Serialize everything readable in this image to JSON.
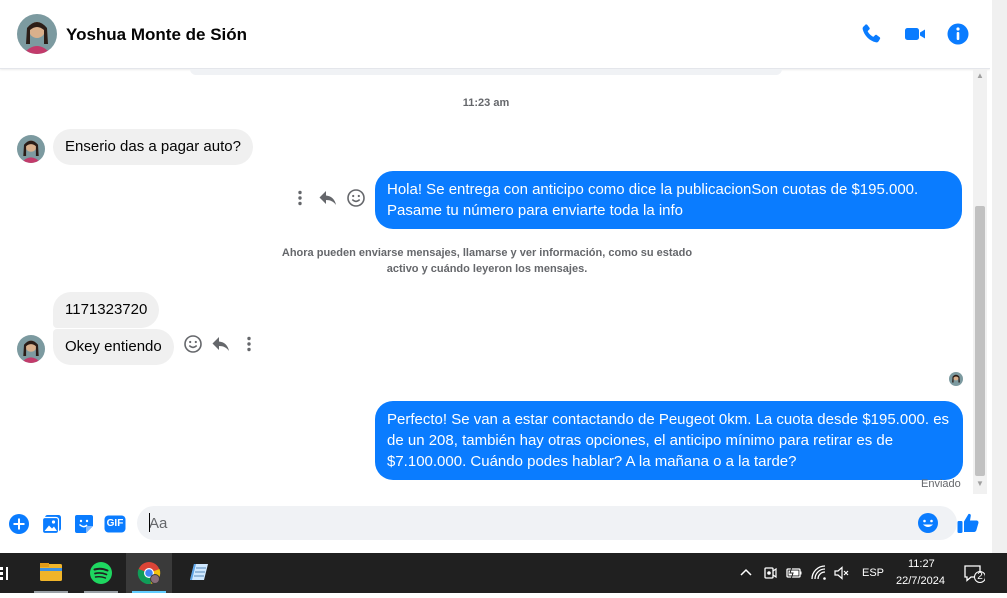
{
  "header": {
    "contact_name": "Yoshua Monte de Sión",
    "icons": [
      "phone-icon",
      "video-camera-icon",
      "info-icon"
    ]
  },
  "thread": {
    "timestamp": "11:23 am",
    "messages": [
      {
        "direction": "in",
        "text": "Enserio das a pagar auto?"
      },
      {
        "direction": "out",
        "lines": [
          "Hola! Se entrega con anticipo como dice la publicacionSon cuotas de $195.000.",
          "Pasame tu número para enviarte toda la info"
        ]
      },
      {
        "direction": "system",
        "lines": [
          "Ahora pueden enviarse mensajes, llamarse y ver información, como su estado",
          "activo y cuándo leyeron los mensajes."
        ]
      },
      {
        "direction": "in",
        "text": "1171323720"
      },
      {
        "direction": "in",
        "text": "Okey entiendo"
      },
      {
        "direction": "out",
        "lines": [
          "Perfecto!  Se van a estar contactando de Peugeot 0km. La cuota desde $195.000. es",
          "de un 208, también hay otras opciones, el anticipo mínimo para retirar es de",
          "$7.100.000. Cuándo podes hablar? A la mañana o a la tarde?"
        ]
      }
    ],
    "status": "Enviado"
  },
  "composer": {
    "placeholder": "Aa",
    "icons": [
      "plus-icon",
      "image-icon",
      "sticker-icon",
      "gif-icon",
      "emoji-icon",
      "thumbs-up-icon"
    ],
    "gif_label": "GIF"
  },
  "taskbar": {
    "language": "ESP",
    "time": "11:27",
    "date": "22/7/2024",
    "notification_count": "2"
  },
  "colors": {
    "accent": "#0a7cff",
    "incoming_bubble": "#f0f0f0",
    "taskbar": "#202020"
  }
}
